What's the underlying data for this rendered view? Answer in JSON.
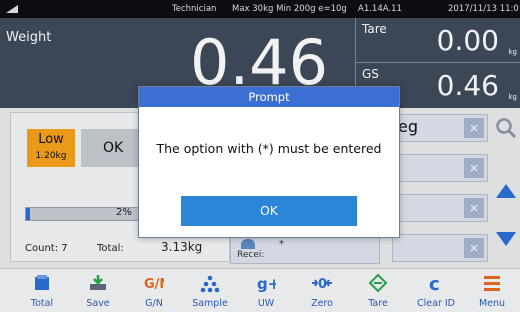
{
  "status_bar": {
    "user": "Technician",
    "range": "Max 30kg  Min 200g  e=10g",
    "version": "A1.14A.11",
    "datetime": "2017/11/13  11:0"
  },
  "display": {
    "weight_label": "Weight",
    "weight_value": "0.46",
    "tare_label": "Tare",
    "tare_value": "0.00",
    "tare_unit": "kg",
    "gs_label": "GS",
    "gs_value": "0.46",
    "gs_unit": "kg"
  },
  "check": {
    "low_label": "Low",
    "low_limit": "1.20kg",
    "ok_label": "OK",
    "progress_text": "2%",
    "progress": 2,
    "count_label": "Count:",
    "count_value": "7",
    "total_label": "Total:",
    "total_value": "3.13kg"
  },
  "fields": {
    "first_text": "eg",
    "receipt_label": "Recei:",
    "receipt_star": "*",
    "clear_symbol": "×"
  },
  "toolbar": [
    {
      "label": "Total",
      "icon": "total-icon"
    },
    {
      "label": "Save",
      "icon": "save-icon"
    },
    {
      "label": "G/N",
      "icon": "gn-icon"
    },
    {
      "label": "Sample",
      "icon": "sample-icon"
    },
    {
      "label": "UW",
      "icon": "uw-icon"
    },
    {
      "label": "Zero",
      "icon": "zero-icon"
    },
    {
      "label": "Tare",
      "icon": "tare-icon"
    },
    {
      "label": "Clear ID",
      "icon": "clear-id-icon"
    },
    {
      "label": "Menu",
      "icon": "menu-icon"
    }
  ],
  "modal": {
    "title": "Prompt",
    "message": "The option with (*) must be entered",
    "ok_label": "OK"
  },
  "colors": {
    "display_bg": "#3f4a5c",
    "accent_blue": "#2b6fd6",
    "low_orange": "#f5a31a",
    "modal_header": "#3b6fd1"
  }
}
